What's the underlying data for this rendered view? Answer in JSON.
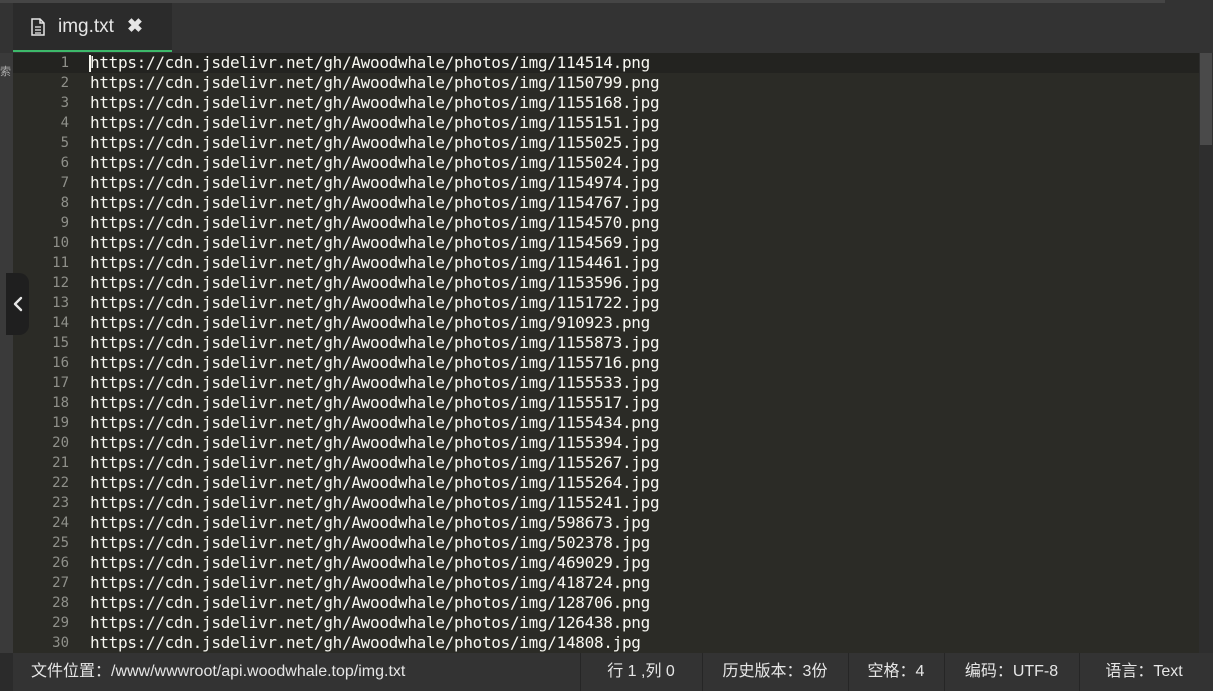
{
  "tab": {
    "title": "img.txt",
    "icon": "file-icon",
    "close": "✖"
  },
  "left_strip": {
    "partial_char": "索"
  },
  "editor": {
    "active_line": 1,
    "lines": [
      "https://cdn.jsdelivr.net/gh/Awoodwhale/photos/img/114514.png",
      "https://cdn.jsdelivr.net/gh/Awoodwhale/photos/img/1150799.png",
      "https://cdn.jsdelivr.net/gh/Awoodwhale/photos/img/1155168.jpg",
      "https://cdn.jsdelivr.net/gh/Awoodwhale/photos/img/1155151.jpg",
      "https://cdn.jsdelivr.net/gh/Awoodwhale/photos/img/1155025.jpg",
      "https://cdn.jsdelivr.net/gh/Awoodwhale/photos/img/1155024.jpg",
      "https://cdn.jsdelivr.net/gh/Awoodwhale/photos/img/1154974.jpg",
      "https://cdn.jsdelivr.net/gh/Awoodwhale/photos/img/1154767.jpg",
      "https://cdn.jsdelivr.net/gh/Awoodwhale/photos/img/1154570.png",
      "https://cdn.jsdelivr.net/gh/Awoodwhale/photos/img/1154569.jpg",
      "https://cdn.jsdelivr.net/gh/Awoodwhale/photos/img/1154461.jpg",
      "https://cdn.jsdelivr.net/gh/Awoodwhale/photos/img/1153596.jpg",
      "https://cdn.jsdelivr.net/gh/Awoodwhale/photos/img/1151722.jpg",
      "https://cdn.jsdelivr.net/gh/Awoodwhale/photos/img/910923.png",
      "https://cdn.jsdelivr.net/gh/Awoodwhale/photos/img/1155873.jpg",
      "https://cdn.jsdelivr.net/gh/Awoodwhale/photos/img/1155716.png",
      "https://cdn.jsdelivr.net/gh/Awoodwhale/photos/img/1155533.jpg",
      "https://cdn.jsdelivr.net/gh/Awoodwhale/photos/img/1155517.jpg",
      "https://cdn.jsdelivr.net/gh/Awoodwhale/photos/img/1155434.png",
      "https://cdn.jsdelivr.net/gh/Awoodwhale/photos/img/1155394.jpg",
      "https://cdn.jsdelivr.net/gh/Awoodwhale/photos/img/1155267.jpg",
      "https://cdn.jsdelivr.net/gh/Awoodwhale/photos/img/1155264.jpg",
      "https://cdn.jsdelivr.net/gh/Awoodwhale/photos/img/1155241.jpg",
      "https://cdn.jsdelivr.net/gh/Awoodwhale/photos/img/598673.jpg",
      "https://cdn.jsdelivr.net/gh/Awoodwhale/photos/img/502378.jpg",
      "https://cdn.jsdelivr.net/gh/Awoodwhale/photos/img/469029.jpg",
      "https://cdn.jsdelivr.net/gh/Awoodwhale/photos/img/418724.png",
      "https://cdn.jsdelivr.net/gh/Awoodwhale/photos/img/128706.png",
      "https://cdn.jsdelivr.net/gh/Awoodwhale/photos/img/126438.png",
      "https://cdn.jsdelivr.net/gh/Awoodwhale/photos/img/14808.jpg"
    ]
  },
  "status": {
    "path": "文件位置：/www/wwwroot/api.woodwhale.top/img.txt",
    "cursor": "行 1 ,列 0",
    "history": "历史版本：3份",
    "indent": "空格：4",
    "encoding": "编码：UTF-8",
    "language": "语言：Text"
  },
  "colors": {
    "accent": "#3db96a",
    "editor_bg": "#2b2b26",
    "text": "#f8f8f2",
    "line_number": "#8f908a"
  }
}
